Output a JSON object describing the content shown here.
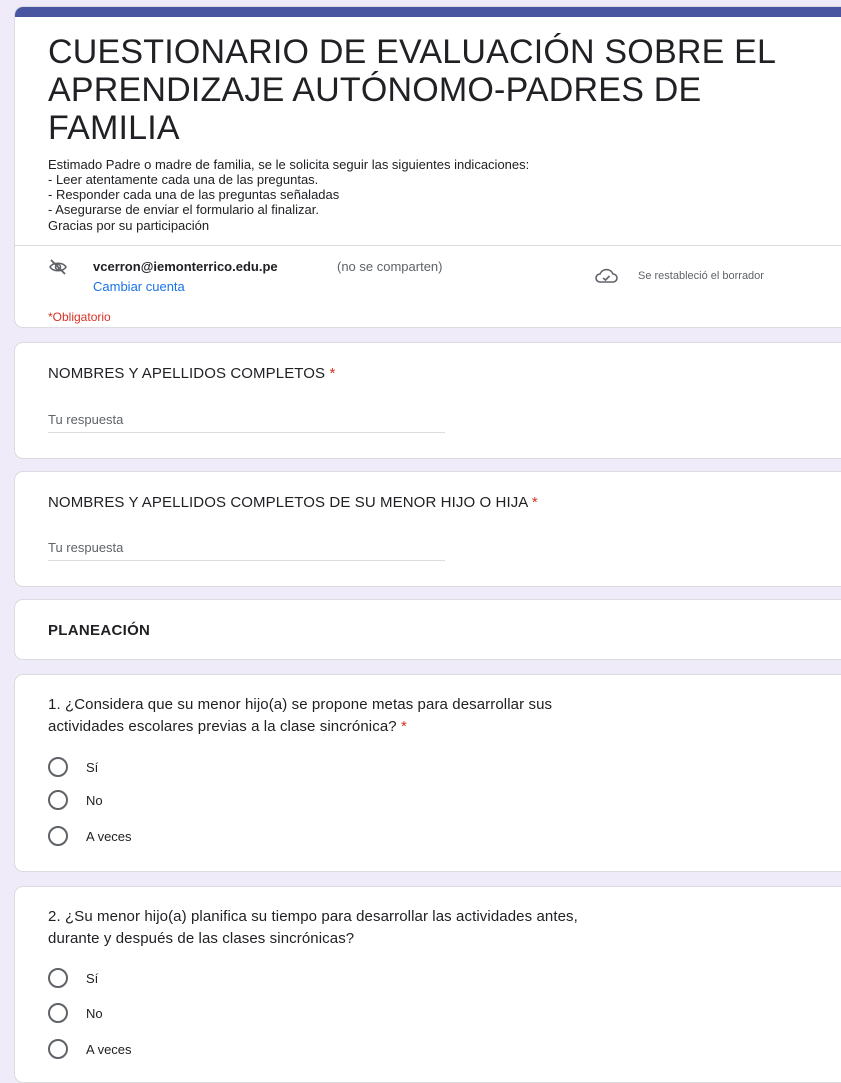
{
  "header": {
    "title": "CUESTIONARIO DE EVALUACIÓN SOBRE EL APRENDIZAJE AUTÓNOMO-PADRES DE FAMILIA",
    "description_lines": [
      "Estimado Padre o madre de familia, se le solicita seguir las siguientes indicaciones:",
      "- Leer atentamente cada una de las preguntas.",
      "- Responder cada una de las preguntas señaladas",
      "- Asegurarse de enviar el formulario al finalizar.",
      "Gracias por su participación"
    ],
    "account_email": "vcerron@iemonterrico.edu.pe",
    "account_note": "(no se comparten)",
    "change_account": "Cambiar cuenta",
    "draft_status": "Se restableció el borrador",
    "required_note": "*Obligatorio",
    "accent_color": "#4a55a2"
  },
  "q_name": {
    "title": "NOMBRES Y APELLIDOS COMPLETOS",
    "required": "*",
    "placeholder": "Tu respuesta"
  },
  "q_child_name": {
    "title": "NOMBRES Y APELLIDOS COMPLETOS DE SU MENOR HIJO O HIJA",
    "required": "*",
    "placeholder": "Tu respuesta"
  },
  "section": {
    "title": "PLANEACIÓN"
  },
  "q1": {
    "title_line1": "1. ¿Considera que su menor hijo(a) se propone metas para desarrollar sus",
    "title_line2": "actividades escolares previas a la clase sincrónica?",
    "required": "*",
    "options": [
      "Sí",
      "No",
      "A veces"
    ]
  },
  "q2": {
    "title_line1": "2. ¿Su menor hijo(a) planifica su tiempo para desarrollar las actividades antes,",
    "title_line2": "durante y después de las clases sincrónicas?",
    "options": [
      "Sí",
      "No",
      "A veces"
    ]
  },
  "icons": {
    "account": "eye-off-icon",
    "draft": "cloud-done-icon"
  }
}
